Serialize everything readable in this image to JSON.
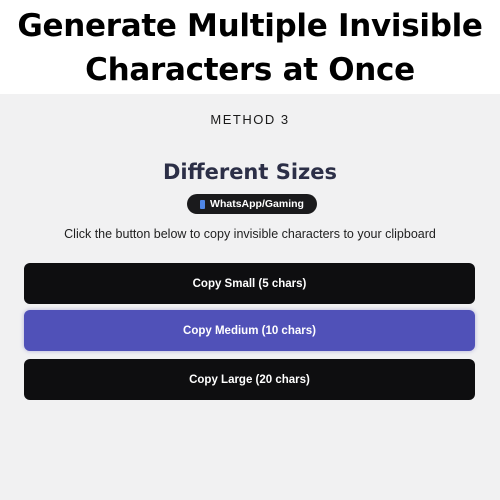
{
  "banner": {
    "title_line1": "Generate Multiple Invisible",
    "title_line2": "Characters at Once"
  },
  "panel": {
    "method_label": "METHOD 3",
    "section_title": "Different Sizes",
    "badge": {
      "icon": "phone-icon",
      "label": "WhatsApp/Gaming"
    },
    "description": "Click the button below to copy invisible characters to your clipboard",
    "buttons": [
      {
        "label": "Copy Small (5 chars)",
        "color": "#0e0e10"
      },
      {
        "label": "Copy Medium (10 chars)",
        "color": "#5051b8"
      },
      {
        "label": "Copy Large (20 chars)",
        "color": "#0e0e10"
      }
    ]
  },
  "colors": {
    "panel_bg": "#f1f1f2",
    "accent": "#5051b8",
    "dark_button": "#0e0e10",
    "title": "#2c2f47"
  }
}
